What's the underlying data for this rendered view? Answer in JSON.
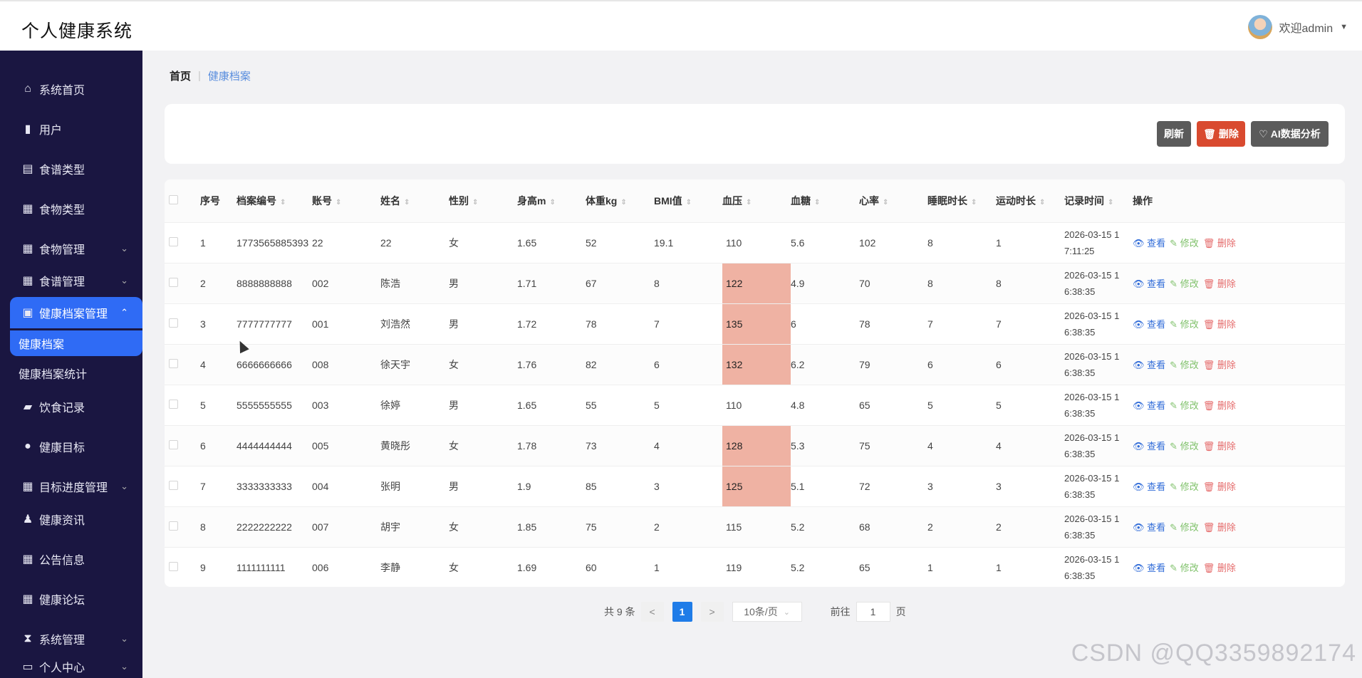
{
  "app": {
    "title": "个人健康系统",
    "welcome": "欢迎admin"
  },
  "sidebar": {
    "items": [
      {
        "label": "系统首页",
        "icon": "home-icon"
      },
      {
        "label": "用户",
        "icon": "bar-chart-icon"
      },
      {
        "label": "食谱类型",
        "icon": "book-icon"
      },
      {
        "label": "食物类型",
        "icon": "grid-icon"
      },
      {
        "label": "食物管理",
        "icon": "grid-icon"
      },
      {
        "label": "食谱管理",
        "icon": "grid-icon"
      },
      {
        "label": "健康档案管理",
        "icon": "clipboard-icon"
      },
      {
        "label": "健康档案"
      },
      {
        "label": "健康档案统计"
      },
      {
        "label": "饮食记录",
        "icon": "briefcase-icon"
      },
      {
        "label": "健康目标",
        "icon": "bulb-icon"
      },
      {
        "label": "目标进度管理",
        "icon": "grid-icon"
      },
      {
        "label": "健康资讯",
        "icon": "person-icon"
      },
      {
        "label": "公告信息",
        "icon": "grid-icon"
      },
      {
        "label": "健康论坛",
        "icon": "grid-icon"
      },
      {
        "label": "系统管理",
        "icon": "hourglass-icon"
      },
      {
        "label": "个人中心",
        "icon": "id-card-icon"
      }
    ]
  },
  "breadcrumb": {
    "home": "首页",
    "current": "健康档案"
  },
  "toolbar": {
    "refresh": "刷新",
    "delete": "删除",
    "ai": "AI数据分析"
  },
  "table": {
    "columns": [
      "序号",
      "档案编号",
      "账号",
      "姓名",
      "性别",
      "身高m",
      "体重kg",
      "BMI值",
      "血压",
      "血糖",
      "心率",
      "睡眠时长",
      "运动时长",
      "记录时间",
      "操作"
    ],
    "actions": {
      "view": "查看",
      "edit": "修改",
      "delete": "删除"
    },
    "rows": [
      {
        "no": "1",
        "code": "1773565885393",
        "account": "22",
        "name": "22",
        "gender": "女",
        "height": "1.65",
        "weight": "52",
        "bmi": "19.1",
        "bp": "110",
        "bp_high": false,
        "sugar": "5.6",
        "hr": "102",
        "sleep": "8",
        "exercise": "1",
        "time1": "2026-03-15 1",
        "time2": "7:11:25"
      },
      {
        "no": "2",
        "code": "8888888888",
        "account": "002",
        "name": "陈浩",
        "gender": "男",
        "height": "1.71",
        "weight": "67",
        "bmi": "8",
        "bp": "122",
        "bp_high": true,
        "sugar": "4.9",
        "hr": "70",
        "sleep": "8",
        "exercise": "8",
        "time1": "2026-03-15 1",
        "time2": "6:38:35"
      },
      {
        "no": "3",
        "code": "7777777777",
        "account": "001",
        "name": "刘浩然",
        "gender": "男",
        "height": "1.72",
        "weight": "78",
        "bmi": "7",
        "bp": "135",
        "bp_high": true,
        "sugar": "6",
        "hr": "78",
        "sleep": "7",
        "exercise": "7",
        "time1": "2026-03-15 1",
        "time2": "6:38:35"
      },
      {
        "no": "4",
        "code": "6666666666",
        "account": "008",
        "name": "徐天宇",
        "gender": "女",
        "height": "1.76",
        "weight": "82",
        "bmi": "6",
        "bp": "132",
        "bp_high": true,
        "sugar": "6.2",
        "hr": "79",
        "sleep": "6",
        "exercise": "6",
        "time1": "2026-03-15 1",
        "time2": "6:38:35"
      },
      {
        "no": "5",
        "code": "5555555555",
        "account": "003",
        "name": "徐婷",
        "gender": "男",
        "height": "1.65",
        "weight": "55",
        "bmi": "5",
        "bp": "110",
        "bp_high": false,
        "sugar": "4.8",
        "hr": "65",
        "sleep": "5",
        "exercise": "5",
        "time1": "2026-03-15 1",
        "time2": "6:38:35"
      },
      {
        "no": "6",
        "code": "4444444444",
        "account": "005",
        "name": "黄晓彤",
        "gender": "女",
        "height": "1.78",
        "weight": "73",
        "bmi": "4",
        "bp": "128",
        "bp_high": true,
        "sugar": "5.3",
        "hr": "75",
        "sleep": "4",
        "exercise": "4",
        "time1": "2026-03-15 1",
        "time2": "6:38:35"
      },
      {
        "no": "7",
        "code": "3333333333",
        "account": "004",
        "name": "张明",
        "gender": "男",
        "height": "1.9",
        "weight": "85",
        "bmi": "3",
        "bp": "125",
        "bp_high": true,
        "sugar": "5.1",
        "hr": "72",
        "sleep": "3",
        "exercise": "3",
        "time1": "2026-03-15 1",
        "time2": "6:38:35"
      },
      {
        "no": "8",
        "code": "2222222222",
        "account": "007",
        "name": "胡宇",
        "gender": "女",
        "height": "1.85",
        "weight": "75",
        "bmi": "2",
        "bp": "115",
        "bp_high": false,
        "sugar": "5.2",
        "hr": "68",
        "sleep": "2",
        "exercise": "2",
        "time1": "2026-03-15 1",
        "time2": "6:38:35"
      },
      {
        "no": "9",
        "code": "1111111111",
        "account": "006",
        "name": "李静",
        "gender": "女",
        "height": "1.69",
        "weight": "60",
        "bmi": "1",
        "bp": "119",
        "bp_high": false,
        "sugar": "5.2",
        "hr": "65",
        "sleep": "1",
        "exercise": "1",
        "time1": "2026-03-15 1",
        "time2": "6:38:35"
      }
    ]
  },
  "pagination": {
    "total": "共 9 条",
    "current_page": "1",
    "page_size": "10条/页",
    "goto_prefix": "前往",
    "goto_value": "1",
    "goto_suffix": "页"
  },
  "watermark": "CSDN @QQ3359892174",
  "colors": {
    "sidebar_bg": "#1a1641",
    "active_blue": "#2f6bf5",
    "bp_high_bg": "#efb2a3",
    "delete_red": "#d94a2f"
  }
}
